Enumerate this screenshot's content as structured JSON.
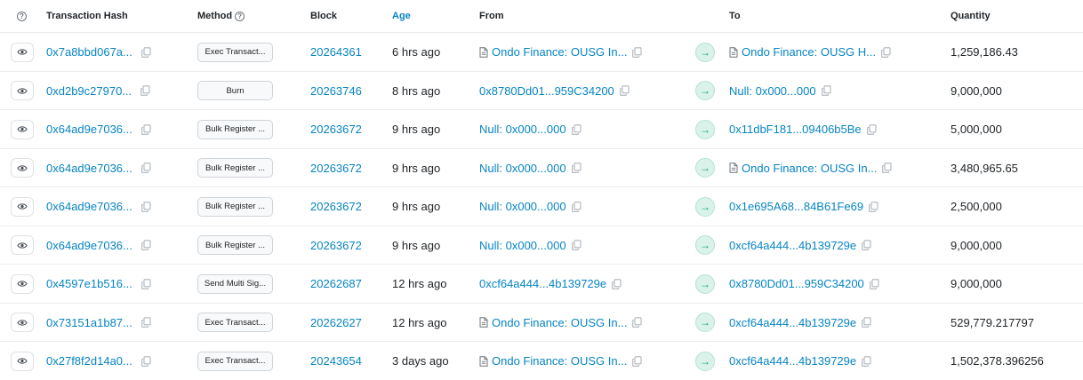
{
  "headers": {
    "transaction_hash": "Transaction Hash",
    "method": "Method",
    "block": "Block",
    "age": "Age",
    "from": "From",
    "to": "To",
    "quantity": "Quantity"
  },
  "colors": {
    "link": "#0784c3",
    "arrow_bg": "#daf2ea",
    "arrow_fg": "#00a186"
  },
  "rows": [
    {
      "hash": "0x7a8bbd067a...",
      "method": "Exec Transact...",
      "block": "20264361",
      "age": "6 hrs ago",
      "from": "Ondo Finance: OUSG In...",
      "from_contract": true,
      "to": "Ondo Finance: OUSG H...",
      "to_contract": true,
      "quantity": "1,259,186.43"
    },
    {
      "hash": "0xd2b9c27970...",
      "method": "Burn",
      "block": "20263746",
      "age": "8 hrs ago",
      "from": "0x8780Dd01...959C34200",
      "from_contract": false,
      "to": "Null: 0x000...000",
      "to_contract": false,
      "quantity": "9,000,000"
    },
    {
      "hash": "0x64ad9e7036...",
      "method": "Bulk Register ...",
      "block": "20263672",
      "age": "9 hrs ago",
      "from": "Null: 0x000...000",
      "from_contract": false,
      "to": "0x11dbF181...09406b5Be",
      "to_contract": false,
      "quantity": "5,000,000"
    },
    {
      "hash": "0x64ad9e7036...",
      "method": "Bulk Register ...",
      "block": "20263672",
      "age": "9 hrs ago",
      "from": "Null: 0x000...000",
      "from_contract": false,
      "to": "Ondo Finance: OUSG In...",
      "to_contract": true,
      "quantity": "3,480,965.65"
    },
    {
      "hash": "0x64ad9e7036...",
      "method": "Bulk Register ...",
      "block": "20263672",
      "age": "9 hrs ago",
      "from": "Null: 0x000...000",
      "from_contract": false,
      "to": "0x1e695A68...84B61Fe69",
      "to_contract": false,
      "quantity": "2,500,000"
    },
    {
      "hash": "0x64ad9e7036...",
      "method": "Bulk Register ...",
      "block": "20263672",
      "age": "9 hrs ago",
      "from": "Null: 0x000...000",
      "from_contract": false,
      "to": "0xcf64a444...4b139729e",
      "to_contract": false,
      "quantity": "9,000,000"
    },
    {
      "hash": "0x4597e1b516...",
      "method": "Send Multi Sig...",
      "block": "20262687",
      "age": "12 hrs ago",
      "from": "0xcf64a444...4b139729e",
      "from_contract": false,
      "to": "0x8780Dd01...959C34200",
      "to_contract": false,
      "quantity": "9,000,000"
    },
    {
      "hash": "0x73151a1b87...",
      "method": "Exec Transact...",
      "block": "20262627",
      "age": "12 hrs ago",
      "from": "Ondo Finance: OUSG In...",
      "from_contract": true,
      "to": "0xcf64a444...4b139729e",
      "to_contract": false,
      "quantity": "529,779.217797"
    },
    {
      "hash": "0x27f8f2d14a0...",
      "method": "Exec Transact...",
      "block": "20243654",
      "age": "3 days ago",
      "from": "Ondo Finance: OUSG In...",
      "from_contract": true,
      "to": "0xcf64a444...4b139729e",
      "to_contract": false,
      "quantity": "1,502,378.396256"
    }
  ]
}
